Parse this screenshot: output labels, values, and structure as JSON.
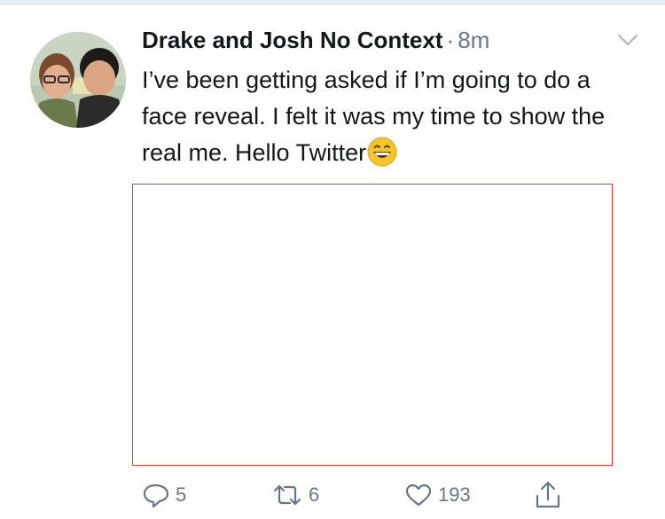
{
  "tweet": {
    "author": {
      "display_name": "Drake and Josh No Context",
      "avatar_icon": "avatar-photo"
    },
    "separator": "·",
    "timestamp": "8m",
    "text": "I’ve been getting asked if I’m going to do a face reveal. I felt it was my time to show the real me. Hello Twitter",
    "emoji": "grinning-face-emoji",
    "media": {
      "frame_color": "#e63b3b"
    },
    "actions": {
      "reply": {
        "icon": "reply-icon",
        "count": "5"
      },
      "retweet": {
        "icon": "retweet-icon",
        "count": "6"
      },
      "like": {
        "icon": "heart-icon",
        "count": "193"
      },
      "share": {
        "icon": "share-icon"
      }
    },
    "menu": {
      "icon": "chevron-down-icon"
    }
  },
  "colors": {
    "text_primary": "#14171a",
    "text_secondary": "#657786",
    "icon_gray": "#657786"
  }
}
